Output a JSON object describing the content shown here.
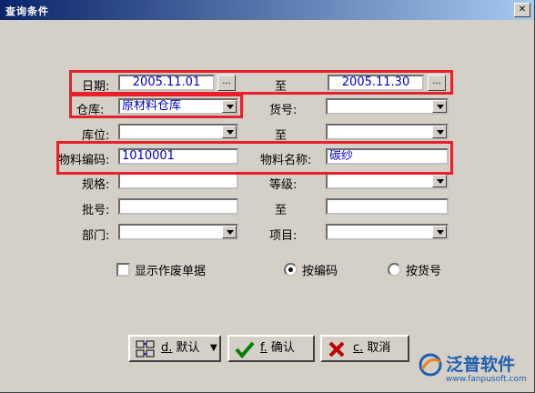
{
  "window": {
    "title": "查询条件"
  },
  "labels": {
    "date": "日期:",
    "to1": "至",
    "warehouse": "仓库:",
    "item_no": "货号:",
    "location": "库位:",
    "to2": "至",
    "material_code": "物料编码:",
    "material_name": "物料名称:",
    "spec": "规格:",
    "grade": "等级:",
    "batch": "批号:",
    "to3": "至",
    "dept": "部门:",
    "project": "项目:"
  },
  "values": {
    "date_from": "2005.11.01",
    "date_to": "2005.11.30",
    "warehouse": "原材料仓库",
    "material_code": "1010001",
    "material_name": "碳纱"
  },
  "ellipsis": "...",
  "options": {
    "show_void": "显示作废单据",
    "by_code": "按编码",
    "by_item": "按货号"
  },
  "buttons": {
    "default_key": "d.",
    "default_label": "默认",
    "ok_key": "f.",
    "ok_label": "确认",
    "cancel_key": "c.",
    "cancel_label": "取消"
  },
  "logo": {
    "name": "泛普软件",
    "url": "www.fanpusoft.com"
  },
  "colors": {
    "highlight": "#e8202a",
    "value_text": "#0000cc"
  }
}
